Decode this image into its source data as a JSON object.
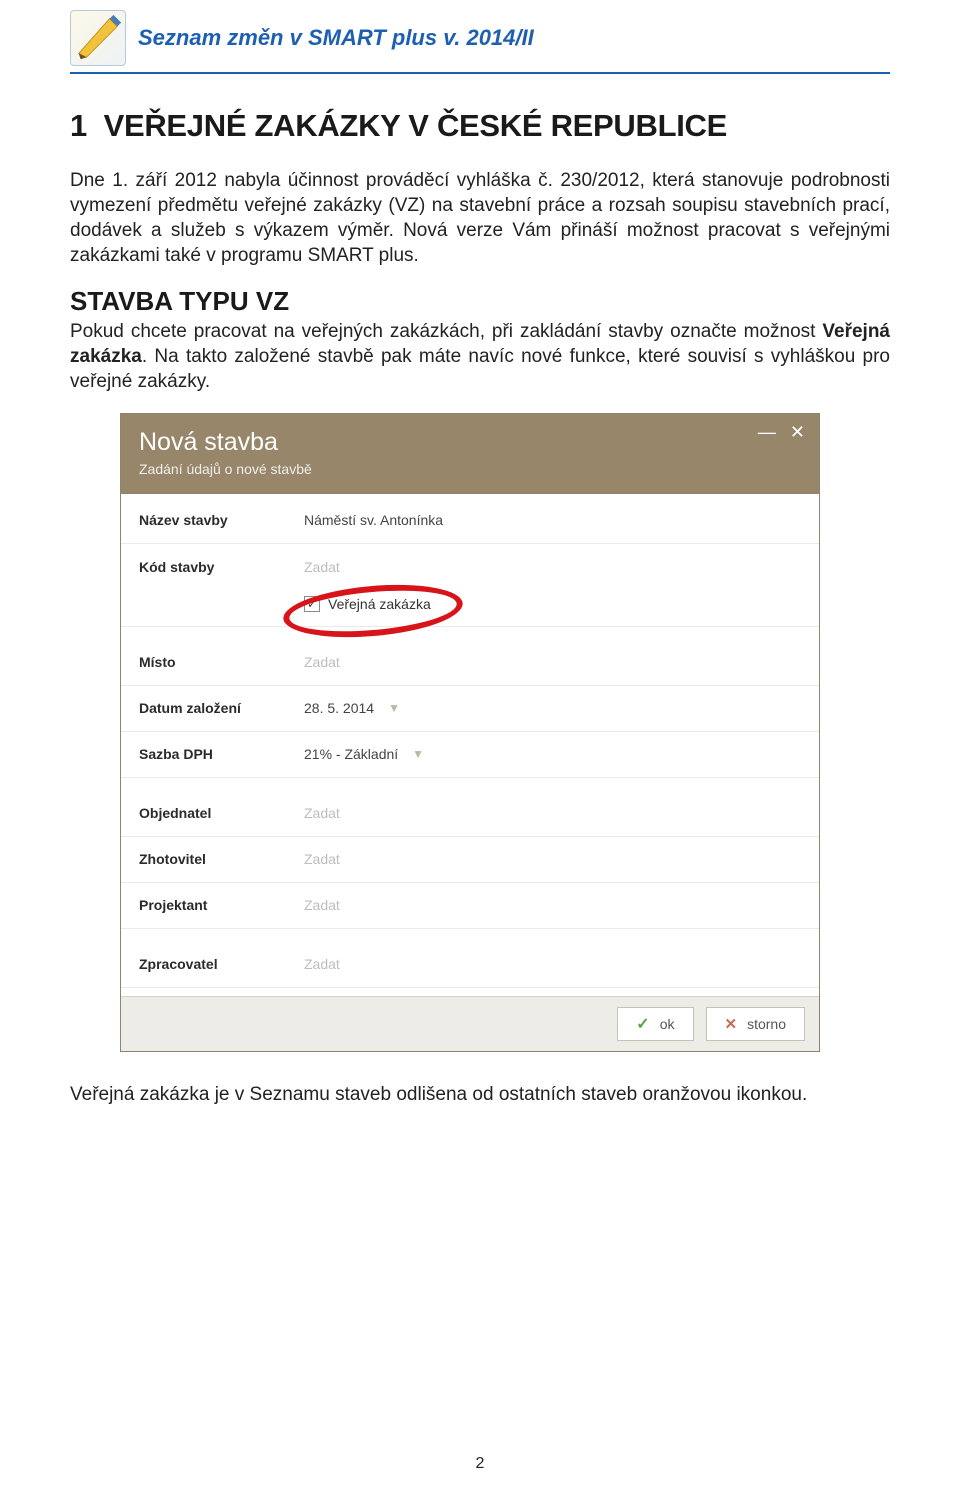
{
  "header": {
    "title": "Seznam změn v SMART plus v. 2014/II"
  },
  "section": {
    "number": "1",
    "title": "VEŘEJNÉ ZAKÁZKY V ČESKÉ REPUBLICE"
  },
  "para1": "Dne 1. září 2012 nabyla účinnost prováděcí vyhláška č. 230/2012, která stanovuje podrobnosti vymezení předmětu veřejné zakázky (VZ) na stavební práce a rozsah soupisu stavebních prací, dodávek a služeb s výkazem výměr. Nová verze Vám přináší možnost pracovat s veřejnými zakázkami také v programu SMART plus.",
  "sub1": {
    "title": "STAVBA TYPU VZ",
    "text_before": "Pokud chcete pracovat na veřejných zakázkách, při zakládání stavby označte možnost ",
    "text_bold": "Veřejná zakázka",
    "text_after": ". Na takto založené stavbě pak máte navíc nové funkce, které souvisí s vyhláškou pro veřejné zakázky."
  },
  "dialog": {
    "title": "Nová stavba",
    "subtitle": "Zadání údajů o nové stavbě",
    "rows": {
      "nazev_label": "Název stavby",
      "nazev_value": "Náměstí sv. Antonínka",
      "kod_label": "Kód stavby",
      "kod_placeholder": "Zadat",
      "check_label": "Veřejná zakázka",
      "misto_label": "Místo",
      "misto_placeholder": "Zadat",
      "datum_label": "Datum založení",
      "datum_value": "28. 5. 2014",
      "sazba_label": "Sazba DPH",
      "sazba_value": "21% - Základní",
      "objednatel_label": "Objednatel",
      "objednatel_placeholder": "Zadat",
      "zhotovitel_label": "Zhotovitel",
      "zhotovitel_placeholder": "Zadat",
      "projektant_label": "Projektant",
      "projektant_placeholder": "Zadat",
      "zpracovatel_label": "Zpracovatel",
      "zpracovatel_placeholder": "Zadat"
    },
    "buttons": {
      "ok": "ok",
      "cancel": "storno"
    }
  },
  "para_footer": "Veřejná zakázka je v Seznamu staveb odlišena od ostatních staveb oranžovou ikonkou.",
  "page_number": "2"
}
